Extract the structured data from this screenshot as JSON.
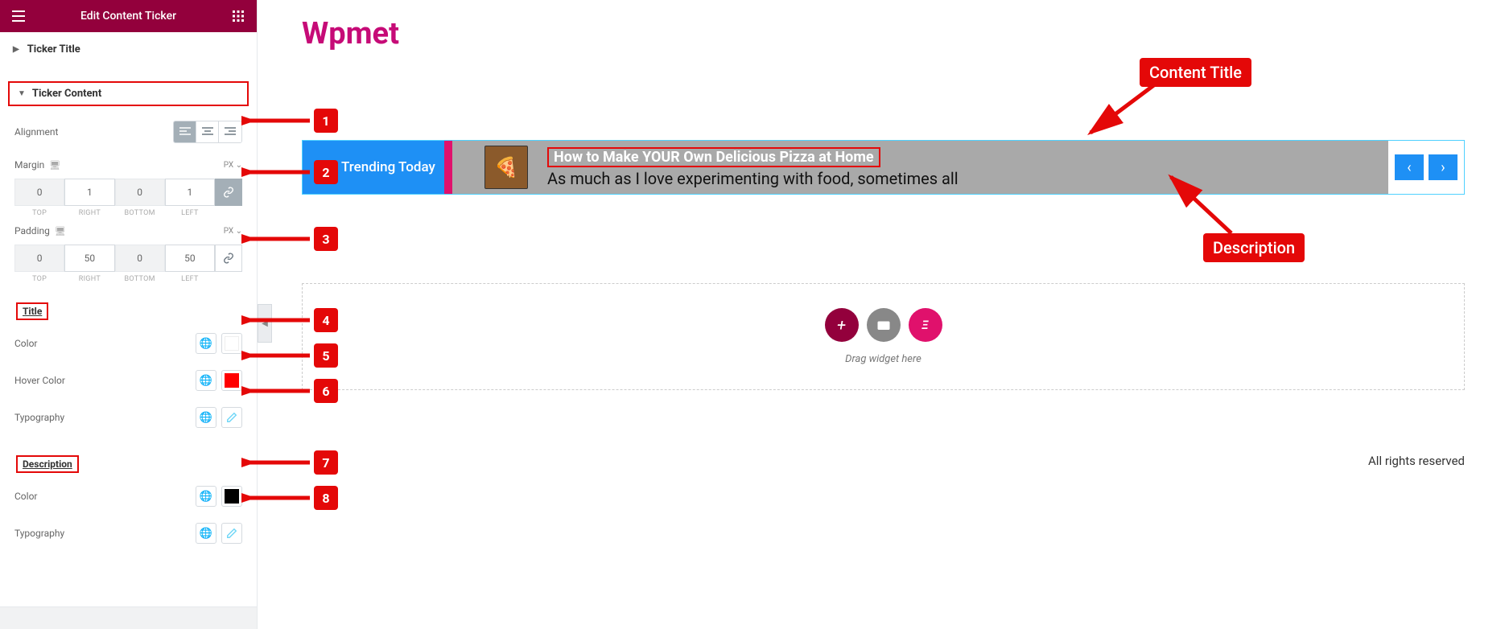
{
  "header": {
    "title": "Edit Content Ticker"
  },
  "sections": {
    "ticker_title": "Ticker Title",
    "ticker_content": "Ticker Content"
  },
  "controls": {
    "alignment_label": "Alignment",
    "margin_label": "Margin",
    "padding_label": "Padding",
    "unit_px": "PX",
    "dim_labels": {
      "top": "TOP",
      "right": "RIGHT",
      "bottom": "BOTTOM",
      "left": "LEFT"
    },
    "margin_vals": {
      "top": "0",
      "right": "1",
      "bottom": "0",
      "left": "1"
    },
    "padding_vals": {
      "top": "0",
      "right": "50",
      "bottom": "0",
      "left": "50"
    },
    "title_section": "Title",
    "desc_section": "Description",
    "color_label": "Color",
    "hover_color_label": "Hover Color",
    "typography_label": "Typography",
    "title_color": "#ffffff",
    "title_hover_color": "#ff0000",
    "desc_color": "#000000"
  },
  "markers": {
    "m1": "1",
    "m2": "2",
    "m3": "3",
    "m4": "4",
    "m5": "5",
    "m6": "6",
    "m7": "7",
    "m8": "8",
    "content_title": "Content Title",
    "description": "Description"
  },
  "preview": {
    "brand": "Wpmet",
    "badge": "Trending Today",
    "content_title": "How to Make YOUR Own Delicious Pizza at Home",
    "content_desc": "As much as I love experimenting with food, sometimes all",
    "drop_hint": "Drag widget here",
    "footer": "All rights reserved"
  }
}
